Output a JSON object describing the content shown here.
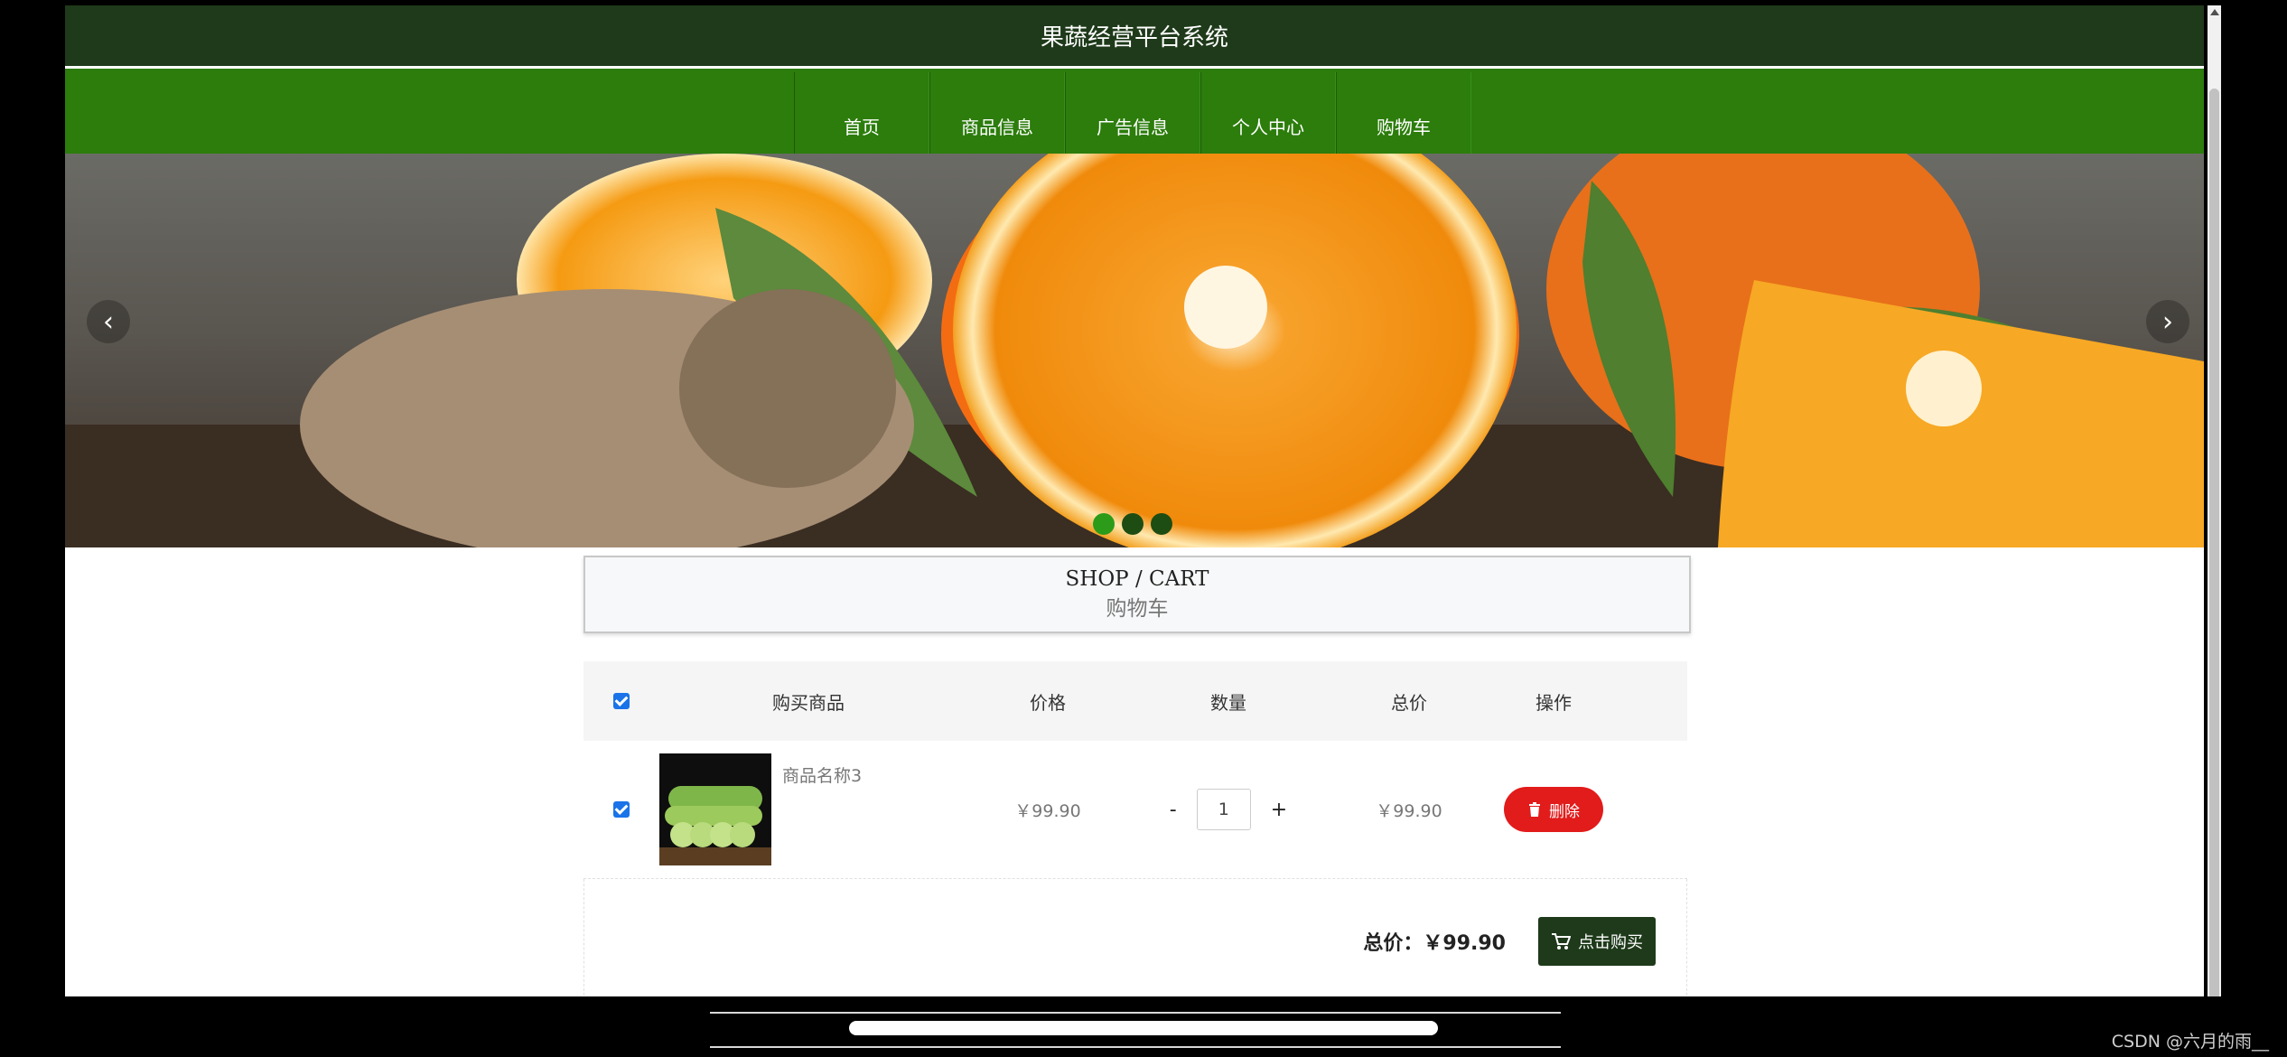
{
  "site": {
    "title": "果蔬经营平台系统"
  },
  "nav": {
    "items": [
      "首页",
      "商品信息",
      "广告信息",
      "个人中心",
      "购物车"
    ]
  },
  "banner": {
    "prev_label": "‹",
    "next_label": "›",
    "dots": 3,
    "active_dot": 0
  },
  "section": {
    "title_en": "SHOP / CART",
    "title_cn": "购物车"
  },
  "cart": {
    "headers": {
      "product": "购买商品",
      "price": "价格",
      "quantity": "数量",
      "total": "总价",
      "action": "操作"
    },
    "items": [
      {
        "name": "商品名称3",
        "price": "￥99.90",
        "quantity": "1",
        "total": "￥99.90",
        "delete_label": "删除",
        "checked": true
      }
    ],
    "qty_minus": "-",
    "qty_plus": "+",
    "summary_label": "总价：",
    "summary_value": "￥99.90",
    "buy_label": "点击购买"
  },
  "watermark": "CSDN @六月的雨__",
  "colors": {
    "header": "#1e3a1a",
    "nav": "#2c7d0c",
    "delete": "#e21b1b"
  }
}
